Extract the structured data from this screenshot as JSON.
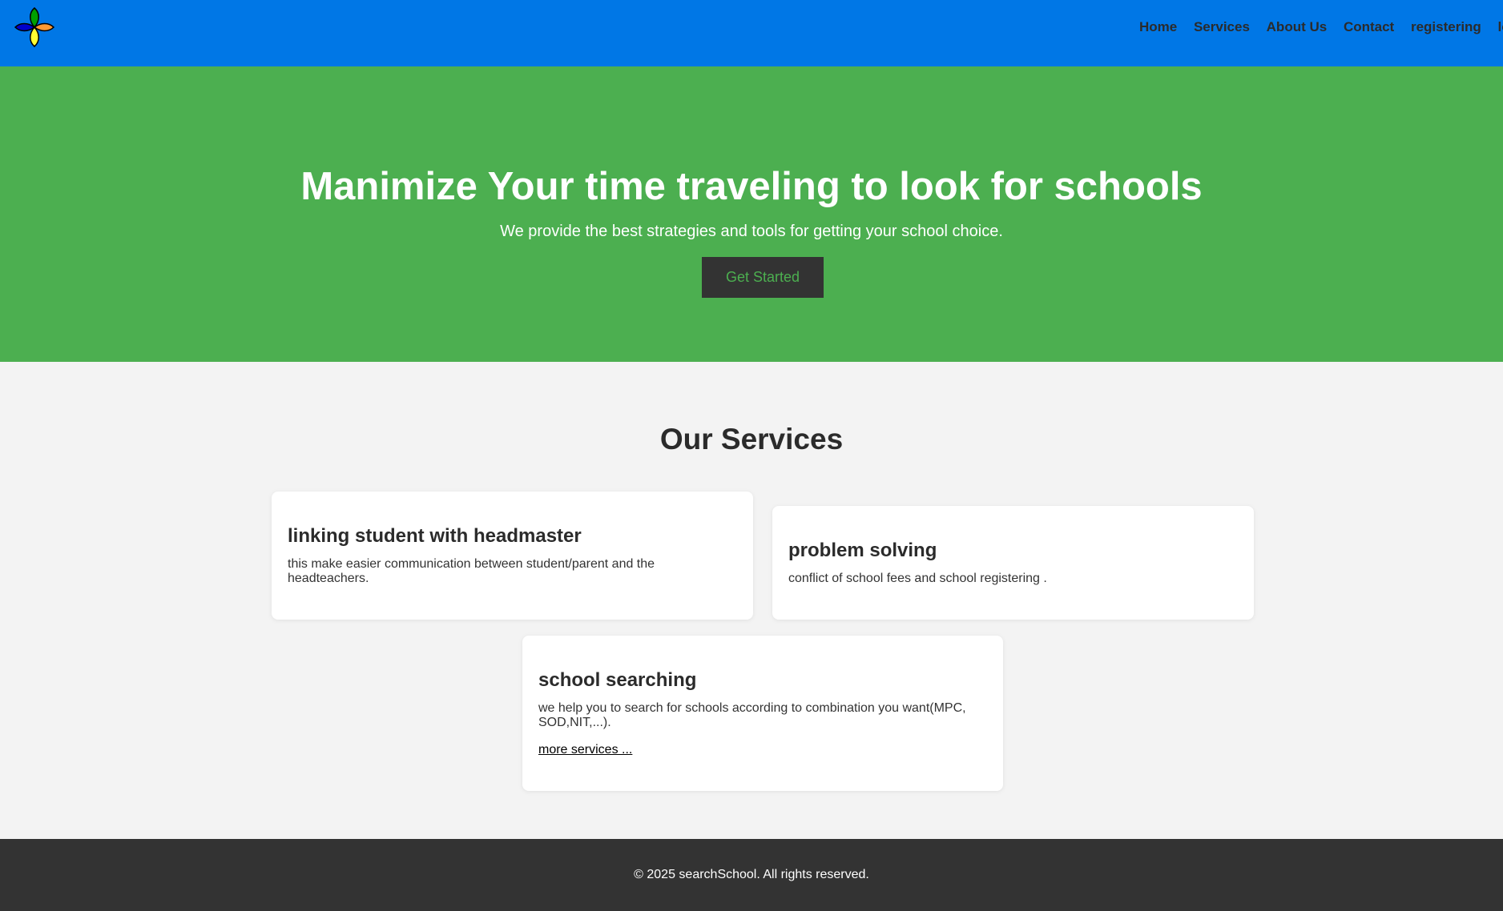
{
  "header": {
    "logo_icon": "four-petal-logo-icon",
    "logo_colors": [
      "#00a000",
      "#ff9933",
      "#ffff33",
      "#0000cc"
    ],
    "nav": [
      {
        "label": "Home"
      },
      {
        "label": "Services"
      },
      {
        "label": "About Us"
      },
      {
        "label": "Contact"
      },
      {
        "label": "registering"
      },
      {
        "label": "login"
      }
    ]
  },
  "hero": {
    "title": "Manimize Your time traveling to look for schools",
    "subtitle": "We provide the best strategies and tools for getting your school choice.",
    "cta_label": "Get Started"
  },
  "services": {
    "title": "Our Services",
    "cards": [
      {
        "title": "linking student with headmaster",
        "text": "this make easier communication between student/parent and the headteachers."
      },
      {
        "title": "problem solving",
        "text": "conflict of school fees and school registering ."
      },
      {
        "title": "school searching",
        "text": "we help you to search for schools according to combination you want(MPC, SOD,NIT,...).",
        "link": "more services ..."
      }
    ]
  },
  "footer": {
    "text": "© 2025 searchSchool. All rights reserved."
  },
  "colors": {
    "header_bg": "#0077e6",
    "hero_bg": "#4caf50",
    "button_bg": "#333333",
    "button_text": "#4caf50",
    "page_bg": "#f3f3f3",
    "footer_bg": "#333333"
  }
}
